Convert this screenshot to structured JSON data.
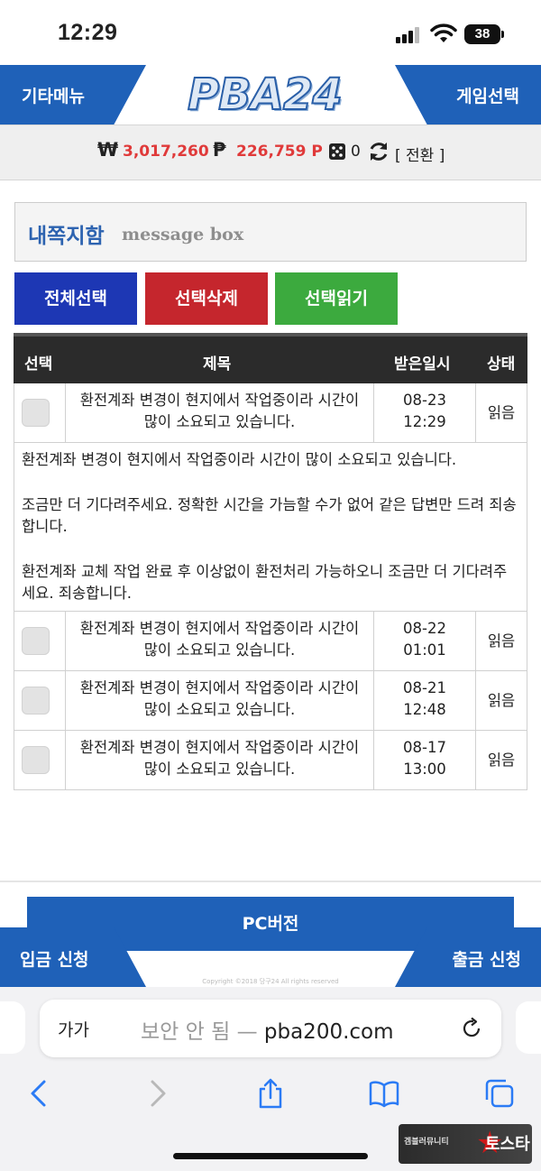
{
  "status_bar": {
    "time": "12:29",
    "battery": "38"
  },
  "header": {
    "left_menu": "기타메뉴",
    "logo": "PBA24",
    "right_menu": "게임선택"
  },
  "balance": {
    "won_symbol": "₩",
    "money": "3,017,260",
    "point_symbol": "₱",
    "points": "226,759 P",
    "dice_count": "0",
    "convert_label": "[ 전환 ]"
  },
  "message_box": {
    "title": "내쪽지함",
    "subtitle": "message box"
  },
  "actions": {
    "select_all": "전체선택",
    "delete_selected": "선택삭제",
    "read_selected": "선택읽기"
  },
  "table": {
    "headers": {
      "select": "선택",
      "title": "제목",
      "received": "받은일시",
      "status": "상태"
    },
    "rows": [
      {
        "title_line1": "환전계좌 변경이 현지에서 작업중이라 시간이",
        "title_line2": "많이 소요되고 있습니다.",
        "date": "08-23",
        "time": "12:29",
        "status": "읽음"
      },
      {
        "title_line1": "환전계좌 변경이 현지에서 작업중이라 시간이",
        "title_line2": "많이 소요되고 있습니다.",
        "date": "08-22",
        "time": "01:01",
        "status": "읽음"
      },
      {
        "title_line1": "환전계좌 변경이 현지에서 작업중이라 시간이",
        "title_line2": "많이 소요되고 있습니다.",
        "date": "08-21",
        "time": "12:48",
        "status": "읽음"
      },
      {
        "title_line1": "환전계좌 변경이 현지에서 작업중이라 시간이",
        "title_line2": "많이 소요되고 있습니다.",
        "date": "08-17",
        "time": "13:00",
        "status": "읽음"
      }
    ],
    "detail": {
      "p1": "환전계좌 변경이 현지에서 작업중이라 시간이 많이 소요되고 있습니다.",
      "p2": "조금만 더 기다려주세요. 정확한 시간을 가늠할 수가 없어 같은 답변만 드려 죄송합니다.",
      "p3": "환전계좌 교체 작업 완료 후 이상없이 환전처리 가능하오니 조금만 더 기다려주세요. 죄송합니다."
    }
  },
  "footer": {
    "pc_version": "PC버전",
    "deposit": "입금 신청",
    "withdraw": "출금 신청",
    "copyright": "Copyright ©2018 당구24 All rights reserved"
  },
  "browser": {
    "aa_label": "가가",
    "insecure_label": "보안 안 됨 —",
    "domain": "pba200.com"
  },
  "watermark": {
    "left_text": "겜블러뮤니티",
    "right_text": "토스타"
  }
}
